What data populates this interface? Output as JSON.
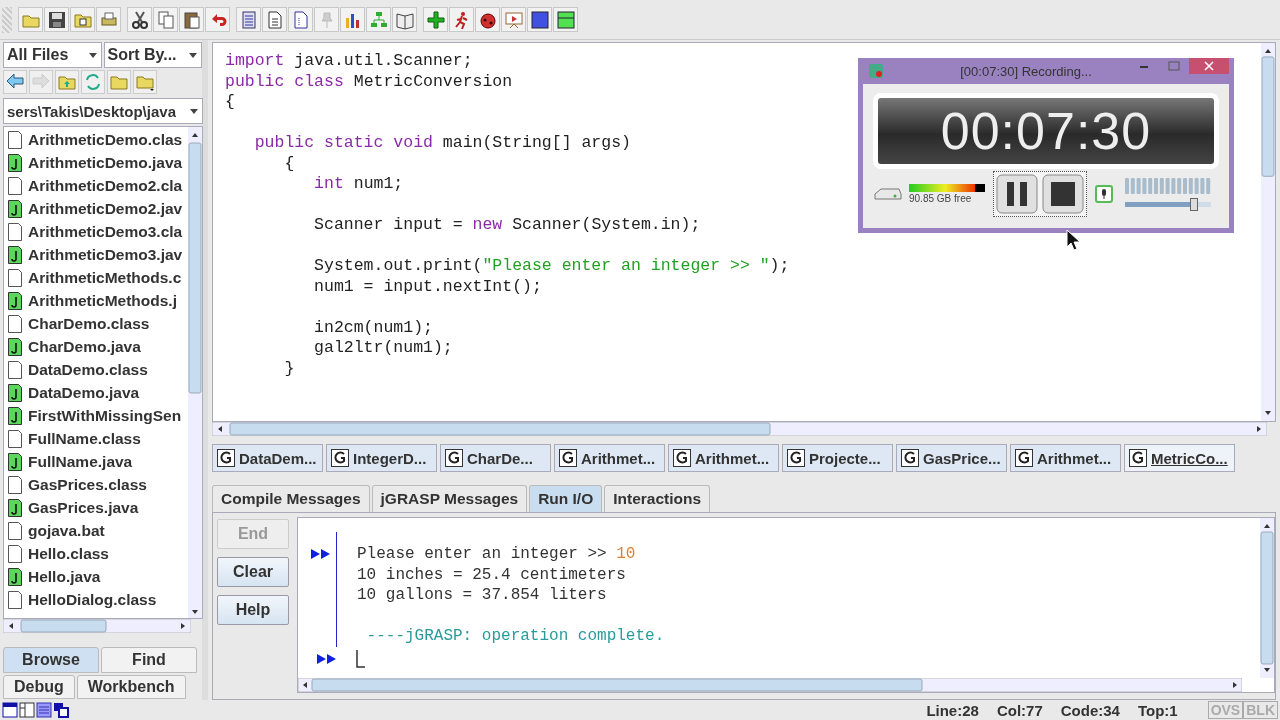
{
  "file_browser": {
    "filter": "All Files",
    "sort": "Sort By...",
    "path": "sers\\Takis\\Desktop\\java",
    "files": [
      {
        "name": "ArithmeticDemo.clas",
        "kind": "class"
      },
      {
        "name": "ArithmeticDemo.java",
        "kind": "java"
      },
      {
        "name": "ArithmeticDemo2.cla",
        "kind": "class"
      },
      {
        "name": "ArithmeticDemo2.jav",
        "kind": "java"
      },
      {
        "name": "ArithmeticDemo3.cla",
        "kind": "class"
      },
      {
        "name": "ArithmeticDemo3.jav",
        "kind": "java"
      },
      {
        "name": "ArithmeticMethods.c",
        "kind": "class"
      },
      {
        "name": "ArithmeticMethods.j",
        "kind": "java"
      },
      {
        "name": "CharDemo.class",
        "kind": "class"
      },
      {
        "name": "CharDemo.java",
        "kind": "java"
      },
      {
        "name": "DataDemo.class",
        "kind": "class"
      },
      {
        "name": "DataDemo.java",
        "kind": "java"
      },
      {
        "name": "FirstWithMissingSen",
        "kind": "java"
      },
      {
        "name": "FullName.class",
        "kind": "class"
      },
      {
        "name": "FullName.java",
        "kind": "java"
      },
      {
        "name": "GasPrices.class",
        "kind": "class"
      },
      {
        "name": "GasPrices.java",
        "kind": "java"
      },
      {
        "name": "gojava.bat",
        "kind": "bat"
      },
      {
        "name": "Hello.class",
        "kind": "class"
      },
      {
        "name": "Hello.java",
        "kind": "java"
      },
      {
        "name": "HelloDialog.class",
        "kind": "class"
      }
    ],
    "tabs": [
      {
        "label": "Browse",
        "selected": true
      },
      {
        "label": "Find",
        "selected": false
      },
      {
        "label": "Debug",
        "selected": false
      },
      {
        "label": "Workbench",
        "selected": false
      }
    ]
  },
  "editor": {
    "lines": [
      {
        "segments": [
          {
            "text": "import",
            "kind": "keyword"
          },
          {
            "text": " java.util.Scanner;",
            "kind": "plain"
          }
        ]
      },
      {
        "segments": [
          {
            "text": "public class",
            "kind": "keyword"
          },
          {
            "text": " MetricConversion",
            "kind": "plain"
          }
        ]
      },
      {
        "segments": [
          {
            "text": "{",
            "kind": "plain"
          }
        ]
      },
      {
        "kind": "blank"
      },
      {
        "segments": [
          {
            "text": "   public static void",
            "kind": "keyword"
          },
          {
            "text": " main(String[] args)",
            "kind": "plain"
          }
        ]
      },
      {
        "segments": [
          {
            "text": "      {",
            "kind": "plain"
          }
        ]
      },
      {
        "segments": [
          {
            "text": "         int",
            "kind": "keyword"
          },
          {
            "text": " num1;",
            "kind": "plain"
          }
        ]
      },
      {
        "kind": "blank"
      },
      {
        "segments": [
          {
            "text": "         Scanner input = ",
            "kind": "plain"
          },
          {
            "text": "new",
            "kind": "keyword"
          },
          {
            "text": " Scanner(System.in);",
            "kind": "plain"
          }
        ]
      },
      {
        "kind": "blank"
      },
      {
        "segments": [
          {
            "text": "         System.out.print(",
            "kind": "plain"
          },
          {
            "text": "\"Please enter an integer >> \"",
            "kind": "string"
          },
          {
            "text": ");",
            "kind": "plain"
          }
        ]
      },
      {
        "segments": [
          {
            "text": "         num1 = input.nextInt();",
            "kind": "plain"
          }
        ]
      },
      {
        "kind": "blank"
      },
      {
        "segments": [
          {
            "text": "         in2cm(num1);",
            "kind": "plain"
          }
        ]
      },
      {
        "segments": [
          {
            "text": "         gal2ltr(num1);",
            "kind": "plain"
          }
        ]
      },
      {
        "segments": [
          {
            "text": "      }",
            "kind": "plain"
          }
        ]
      }
    ]
  },
  "file_tabs": [
    {
      "label": "DataDem...",
      "selected": false
    },
    {
      "label": "IntegerD...",
      "selected": false
    },
    {
      "label": "CharDe...",
      "selected": false
    },
    {
      "label": "Arithmet...",
      "selected": false
    },
    {
      "label": "Arithmet...",
      "selected": false
    },
    {
      "label": "Projecte...",
      "selected": false
    },
    {
      "label": "GasPrice...",
      "selected": false
    },
    {
      "label": "Arithmet...",
      "selected": false
    },
    {
      "label": "MetricCo...",
      "selected": true
    }
  ],
  "message_tabs": [
    {
      "label": "Compile Messages",
      "selected": false
    },
    {
      "label": "jGRASP Messages",
      "selected": false
    },
    {
      "label": "Run I/O",
      "selected": true
    },
    {
      "label": "Interactions",
      "selected": false
    }
  ],
  "run_io": {
    "buttons": [
      {
        "label": "End",
        "disabled": true
      },
      {
        "label": "Clear",
        "disabled": false
      },
      {
        "label": "Help",
        "disabled": false
      }
    ],
    "lines": [
      {
        "kind": "prompted",
        "segments": [
          {
            "text": "Please enter an integer >> ",
            "kind": "output"
          },
          {
            "text": "10",
            "kind": "input"
          }
        ]
      },
      {
        "kind": "plain",
        "segments": [
          {
            "text": "10 inches = 25.4 centimeters",
            "kind": "output"
          }
        ]
      },
      {
        "kind": "plain",
        "segments": [
          {
            "text": "10 gallons = 37.854 liters",
            "kind": "output"
          }
        ]
      },
      {
        "kind": "blank"
      },
      {
        "kind": "plain",
        "segments": [
          {
            "text": " ----jGRASP: operation complete.",
            "kind": "status"
          }
        ]
      }
    ]
  },
  "recorder": {
    "title": "[00:07:30] Recording...",
    "time": "00:07:30",
    "disk_free": "90.85 GB free",
    "disk": {
      "level": 0.87
    },
    "volume": {
      "level": 0.8
    }
  },
  "status_bar": {
    "items": [
      "Line:28",
      "Col:77",
      "Code:34",
      "Top:1"
    ],
    "modes": [
      "OVS",
      "BLK"
    ]
  }
}
